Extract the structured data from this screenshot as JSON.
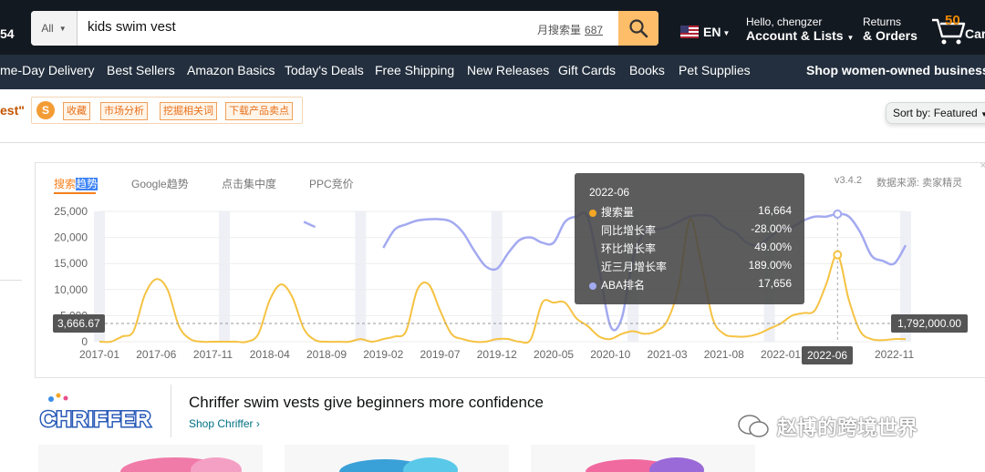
{
  "header": {
    "left_cutoff_text": "54",
    "search": {
      "category": "All",
      "query": "kids swim vest",
      "monthly_volume_label": "月搜索量",
      "monthly_volume_value": "687"
    },
    "language": "EN",
    "account": {
      "greeting": "Hello, chengzer",
      "label": "Account & Lists"
    },
    "returns": {
      "line1": "Returns",
      "line2": "& Orders"
    },
    "cart": {
      "count": "50",
      "label": "Cart"
    }
  },
  "subnav": {
    "items": [
      "me-Day Delivery",
      "Best Sellers",
      "Amazon Basics",
      "Today's Deals",
      "Free Shipping",
      "New Releases",
      "Gift Cards",
      "Books",
      "Pet Supplies"
    ],
    "promo": "Shop women-owned businesses"
  },
  "toolbar": {
    "query_fragment": "est\"",
    "plugin_logo": "S",
    "plugin_buttons": [
      "收藏",
      "市场分析",
      "挖掘相关词",
      "下载产品卖点"
    ],
    "sort_label": "Sort by:",
    "sort_value": "Featured"
  },
  "chart_panel": {
    "tabs": [
      {
        "label_a": "搜索",
        "label_b": "趋势"
      },
      {
        "label": "Google趋势"
      },
      {
        "label": "点击集中度"
      },
      {
        "label": "PPC竞价"
      }
    ],
    "version": "v3.4.2",
    "source": "数据来源: 卖家精灵",
    "close": "×"
  },
  "chart_data": {
    "type": "line",
    "title": "",
    "xlabel": "",
    "ylabel": "",
    "ylim": [
      0,
      25000
    ],
    "y_ticks": [
      "25,000",
      "20,000",
      "15,000",
      "10,000",
      "5,000",
      "0"
    ],
    "x_ticks": [
      "2017-01",
      "2017-06",
      "2017-11",
      "2018-04",
      "2018-09",
      "2019-02",
      "2019-07",
      "2019-12",
      "2020-05",
      "2020-10",
      "2021-03",
      "2021-08",
      "2022-01",
      "2022-06",
      "2022-11"
    ],
    "series": [
      {
        "name": "搜索量",
        "color": "#f5c242",
        "points": [
          [
            "2017-01",
            0
          ],
          [
            "2017-02",
            0
          ],
          [
            "2017-03",
            1000
          ],
          [
            "2017-04",
            2000
          ],
          [
            "2017-05",
            9000
          ],
          [
            "2017-06",
            12000
          ],
          [
            "2017-07",
            10000
          ],
          [
            "2017-08",
            3000
          ],
          [
            "2017-09",
            500
          ],
          [
            "2017-10",
            0
          ],
          [
            "2017-11",
            0
          ],
          [
            "2017-12",
            0
          ],
          [
            "2018-01",
            0
          ],
          [
            "2018-02",
            0
          ],
          [
            "2018-03",
            1500
          ],
          [
            "2018-04",
            8000
          ],
          [
            "2018-05",
            11000
          ],
          [
            "2018-06",
            8500
          ],
          [
            "2018-07",
            2500
          ],
          [
            "2018-08",
            300
          ],
          [
            "2018-09",
            0
          ],
          [
            "2018-10",
            0
          ],
          [
            "2018-11",
            0
          ],
          [
            "2018-12",
            500
          ],
          [
            "2019-01",
            0
          ],
          [
            "2019-02",
            500
          ],
          [
            "2019-03",
            1000
          ],
          [
            "2019-04",
            2000
          ],
          [
            "2019-05",
            10000
          ],
          [
            "2019-06",
            11000
          ],
          [
            "2019-07",
            6000
          ],
          [
            "2019-08",
            1500
          ],
          [
            "2019-09",
            500
          ],
          [
            "2019-10",
            0
          ],
          [
            "2019-11",
            0
          ],
          [
            "2019-12",
            500
          ],
          [
            "2020-01",
            500
          ],
          [
            "2020-02",
            0
          ],
          [
            "2020-03",
            500
          ],
          [
            "2020-04",
            7500
          ],
          [
            "2020-05",
            7500
          ],
          [
            "2020-06",
            7500
          ],
          [
            "2020-07",
            4500
          ],
          [
            "2020-08",
            3000
          ],
          [
            "2020-09",
            1000
          ],
          [
            "2020-10",
            500
          ],
          [
            "2020-11",
            1500
          ],
          [
            "2020-12",
            2000
          ],
          [
            "2021-01",
            1500
          ],
          [
            "2021-02",
            2000
          ],
          [
            "2021-03",
            4000
          ],
          [
            "2021-04",
            10500
          ],
          [
            "2021-05",
            23500
          ],
          [
            "2021-06",
            15000
          ],
          [
            "2021-07",
            4500
          ],
          [
            "2021-08",
            1500
          ],
          [
            "2021-09",
            1000
          ],
          [
            "2021-10",
            1000
          ],
          [
            "2021-11",
            1500
          ],
          [
            "2021-12",
            2500
          ],
          [
            "2022-01",
            3500
          ],
          [
            "2022-02",
            5000
          ],
          [
            "2022-03",
            5500
          ],
          [
            "2022-04",
            6000
          ],
          [
            "2022-05",
            11000
          ],
          [
            "2022-06",
            16664
          ],
          [
            "2022-07",
            8000
          ],
          [
            "2022-08",
            2000
          ],
          [
            "2022-09",
            500
          ],
          [
            "2022-10",
            300
          ],
          [
            "2022-11",
            500
          ],
          [
            "2022-12",
            500
          ]
        ]
      },
      {
        "name": "ABA排名",
        "color": "#a3aaf0",
        "inverse_axis": true,
        "segments": [
          [
            [
              "2018-07",
              0.92
            ],
            [
              "2018-08",
              0.88
            ]
          ],
          [
            [
              "2019-02",
              0.72
            ],
            [
              "2019-03",
              0.86
            ],
            [
              "2019-04",
              0.9
            ],
            [
              "2019-05",
              0.93
            ],
            [
              "2019-06",
              0.94
            ],
            [
              "2019-07",
              0.94
            ],
            [
              "2019-08",
              0.92
            ],
            [
              "2019-09",
              0.84
            ],
            [
              "2019-10",
              0.7
            ],
            [
              "2019-11",
              0.58
            ],
            [
              "2019-12",
              0.56
            ],
            [
              "2020-01",
              0.68
            ],
            [
              "2020-02",
              0.78
            ],
            [
              "2020-03",
              0.8
            ],
            [
              "2020-04",
              0.76
            ],
            [
              "2020-05",
              0.76
            ],
            [
              "2020-06",
              0.92
            ],
            [
              "2020-07",
              0.96
            ],
            [
              "2020-08",
              0.96
            ],
            [
              "2020-09",
              0.56
            ],
            [
              "2020-10",
              0.12
            ],
            [
              "2020-11",
              0.18
            ],
            [
              "2020-12",
              0.64
            ],
            [
              "2021-01",
              0.84
            ],
            [
              "2021-02",
              0.86
            ],
            [
              "2021-03",
              0.88
            ],
            [
              "2021-04",
              0.92
            ],
            [
              "2021-05",
              0.96
            ],
            [
              "2021-06",
              0.97
            ],
            [
              "2021-07",
              0.96
            ],
            [
              "2021-08",
              0.88
            ],
            [
              "2021-09",
              0.84
            ],
            [
              "2021-10",
              0.76
            ],
            [
              "2021-11",
              0.74
            ],
            [
              "2021-12",
              0.8
            ],
            [
              "2022-01",
              0.86
            ],
            [
              "2022-02",
              0.88
            ],
            [
              "2022-03",
              0.93
            ],
            [
              "2022-04",
              0.96
            ],
            [
              "2022-05",
              0.96
            ],
            [
              "2022-06",
              0.98
            ],
            [
              "2022-07",
              0.96
            ],
            [
              "2022-08",
              0.84
            ],
            [
              "2022-09",
              0.66
            ],
            [
              "2022-10",
              0.62
            ],
            [
              "2022-11",
              0.6
            ],
            [
              "2022-12",
              0.74
            ]
          ]
        ]
      }
    ],
    "guide_marker_left": "3,666.67",
    "guide_marker_right": "1,792,000.00",
    "active_x_label": "2022-06",
    "tooltip": {
      "title": "2022-06",
      "rows": [
        {
          "label": "搜索量",
          "value": "16,664",
          "color": "#f5a623"
        },
        {
          "label": "同比增长率",
          "value": "-28.00%"
        },
        {
          "label": "环比增长率",
          "value": "49.00%"
        },
        {
          "label": "近三月增长率",
          "value": "189.00%"
        },
        {
          "label": "ABA排名",
          "value": "17,656",
          "color": "#a3aaf0"
        }
      ]
    }
  },
  "brand_banner": {
    "logo_text": "CHRIFFER",
    "headline": "Chriffer swim vests give beginners more confidence",
    "link": "Shop Chriffer ›"
  },
  "watermark": "赵博的跨境世界"
}
